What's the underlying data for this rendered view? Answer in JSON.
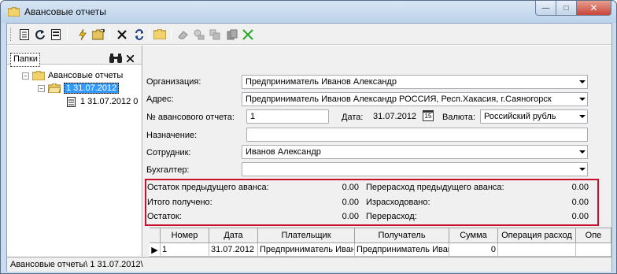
{
  "window": {
    "title": "Авансовые отчеты",
    "minimize_glyph": "—",
    "maximize_glyph": "□",
    "close_glyph": "✕"
  },
  "toolbar": {
    "icons": [
      "document-icon",
      "refresh-icon",
      "list-icon",
      "lightning-icon",
      "open-folder-icon",
      "delete-icon",
      "sync-icon",
      "folder-icon",
      "eraser-icon",
      "stamp-icon",
      "copy-disabled-icon",
      "pages-disabled-icon",
      "check-icon"
    ]
  },
  "left_pane": {
    "tab_label": "Папки",
    "tree": [
      {
        "label": "Авансовые отчеты",
        "expander": "−",
        "level": 0
      },
      {
        "label": "1 31.07.2012",
        "expander": "−",
        "level": 1,
        "selected": true
      },
      {
        "label": "1 31.07.2012 0",
        "level": 2
      }
    ]
  },
  "form": {
    "org_label": "Организация:",
    "org_value": "Предприниматель Иванов Александр",
    "address_label": "Адрес:",
    "address_value": "Предприниматель Иванов Александр РОССИЯ, Респ.Хакасия, г.Саяногорск",
    "report_no_label": "№ авансового отчета:",
    "report_no_value": "1",
    "date_label": "Дата:",
    "date_value": "31.07.2012",
    "calendar_glyph": "15",
    "currency_label": "Валюта:",
    "currency_value": "Российский рубль",
    "purpose_label": "Назначение:",
    "purpose_value": "",
    "employee_label": "Сотрудник:",
    "employee_value": "Иванов Александр",
    "accountant_label": "Бухгалтер:",
    "accountant_value": ""
  },
  "summary": {
    "prev_balance_label": "Остаток предыдущего аванса:",
    "prev_balance_value": "0.00",
    "prev_overspend_label": "Перерасход предыдущего аванса:",
    "prev_overspend_value": "0.00",
    "received_label": "Итого получено:",
    "received_value": "0.00",
    "spent_label": "Израсходовано:",
    "spent_value": "0.00",
    "balance_label": "Остаток:",
    "balance_value": "0.00",
    "overspend_label": "Перерасход:",
    "overspend_value": "0.00"
  },
  "grid": {
    "columns": [
      "Номер",
      "Дата",
      "Плательщик",
      "Получатель",
      "Сумма",
      "Операция расход",
      "Опе"
    ],
    "rows": [
      {
        "indicator": "▶",
        "cells": [
          "1",
          "31.07.2012",
          "Предприниматель Иван",
          "Предприниматель Иван",
          "0",
          "",
          ""
        ]
      }
    ]
  },
  "status": {
    "path": "Авансовые отчеты\\ 1 31.07.2012\\"
  },
  "colors": {
    "highlight_border": "#c8102e",
    "selection": "#3399ff",
    "window_frame": "#c9dcef"
  }
}
